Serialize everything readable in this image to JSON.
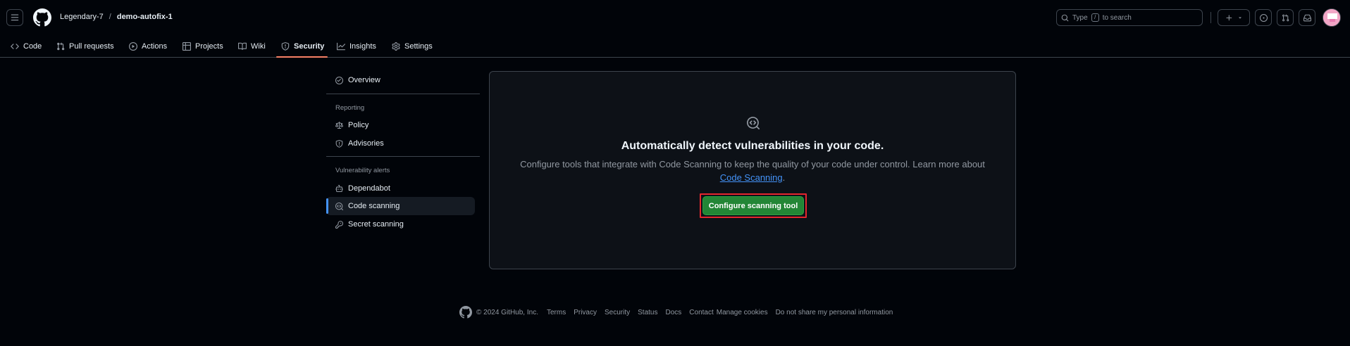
{
  "header": {
    "owner": "Legendary-7",
    "separator": "/",
    "repo": "demo-autofix-1",
    "search": {
      "prefix": "Type",
      "key": "/",
      "suffix": "to search"
    },
    "icons": [
      "hamburger-icon",
      "github-logo-icon",
      "search-icon",
      "plus-icon",
      "triangle-down-icon",
      "issue-opened-icon",
      "git-pull-request-icon",
      "inbox-icon",
      "avatar"
    ]
  },
  "repo_nav": {
    "tabs": [
      {
        "label": "Code",
        "icon": "code-icon"
      },
      {
        "label": "Pull requests",
        "icon": "git-pull-request-icon"
      },
      {
        "label": "Actions",
        "icon": "play-icon"
      },
      {
        "label": "Projects",
        "icon": "table-icon"
      },
      {
        "label": "Wiki",
        "icon": "book-icon"
      },
      {
        "label": "Security",
        "icon": "shield-icon",
        "active": true
      },
      {
        "label": "Insights",
        "icon": "graph-icon"
      },
      {
        "label": "Settings",
        "icon": "gear-icon"
      }
    ]
  },
  "sidebar": {
    "overview": "Overview",
    "reporting_heading": "Reporting",
    "policy": "Policy",
    "advisories": "Advisories",
    "alerts_heading": "Vulnerability alerts",
    "dependabot": "Dependabot",
    "code_scanning": "Code scanning",
    "secret_scanning": "Secret scanning"
  },
  "main": {
    "title": "Automatically detect vulnerabilities in your code.",
    "description": "Configure tools that integrate with Code Scanning to keep the quality of your code under control. Learn more about",
    "link": "Code Scanning",
    "period": ".",
    "cta": "Configure scanning tool"
  },
  "footer": {
    "copyright": "© 2024 GitHub, Inc.",
    "links": [
      "Terms",
      "Privacy",
      "Security",
      "Status",
      "Docs",
      "Contact",
      "Manage cookies",
      "Do not share my personal information"
    ]
  },
  "colors": {
    "background": "#010409",
    "accent_blue": "#4493f8",
    "active_tab": "#f78166",
    "primary_button": "#238636",
    "highlight_outline": "#e5262e"
  }
}
